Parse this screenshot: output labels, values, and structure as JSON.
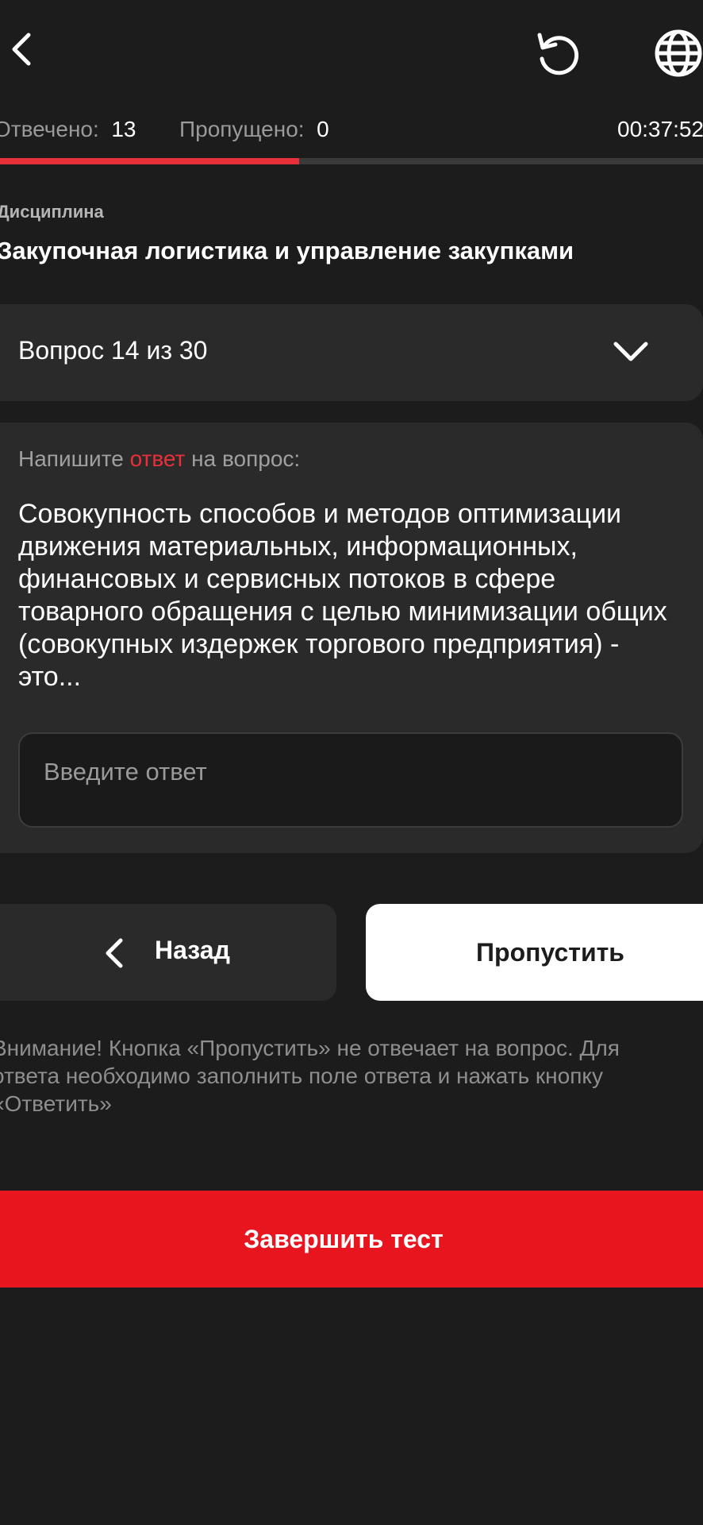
{
  "header": {
    "back_icon": "chevron-left-icon",
    "refresh_icon": "refresh-icon",
    "language_icon": "globe-icon"
  },
  "stats": {
    "answered_label": "Отвечено:",
    "answered_value": "13",
    "skipped_label": "Пропущено:",
    "skipped_value": "0",
    "timer": "00:37:52",
    "progress": 0.425
  },
  "discipline": {
    "label": "Дисциплина",
    "title": "Закупочная логистика и управление закупками"
  },
  "question_selector": {
    "label": "Вопрос 14 из 30",
    "icon": "chevron-down-icon"
  },
  "question": {
    "prompt_before": "Напишите ",
    "prompt_accent": "ответ",
    "prompt_after": " на вопрос:",
    "text": "Совокупность способов и методов оптимизации движения материальных, информационных, финансовых и сервисных потоков в сфере товарного обращения с целью минимизации общих (совокупных издержек торгового предприятия) - это...",
    "input_placeholder": "Введите ответ",
    "input_value": ""
  },
  "buttons": {
    "back_label": "Назад",
    "skip_label": "Пропустить",
    "finish_label": "Завершить тест"
  },
  "notice": "Внимание! Кнопка «Пропустить» не отвечает на вопрос. Для ответа необходимо заполнить поле ответа и нажать кнопку «Ответить»",
  "colors": {
    "background": "#1c1c1c",
    "card": "#2a2a2a",
    "accent": "#e8303a",
    "finish": "#e8141e"
  }
}
